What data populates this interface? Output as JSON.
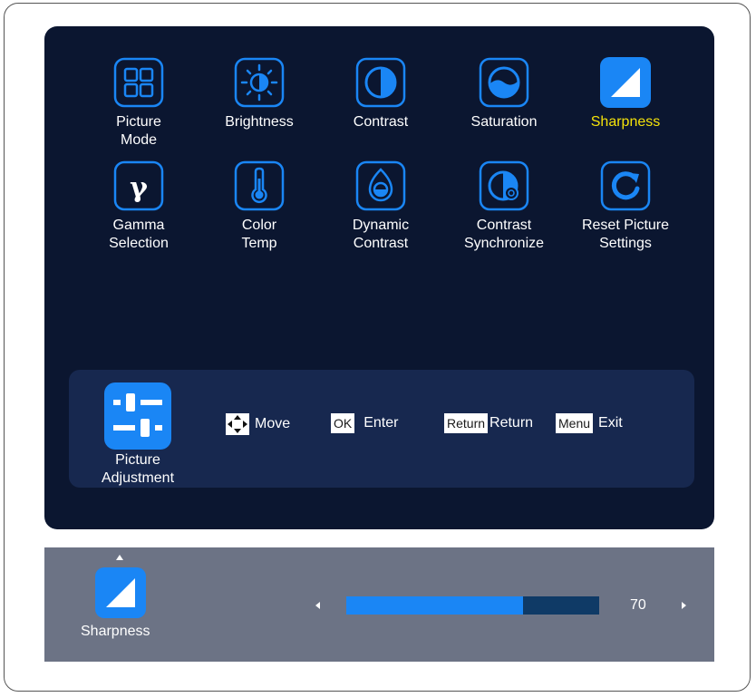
{
  "menu": {
    "active_color": "#f4e20a",
    "accent_color": "#1a86f5",
    "items": [
      {
        "label": "Picture\nMode",
        "icon": "picture-mode-icon"
      },
      {
        "label": "Brightness",
        "icon": "brightness-icon"
      },
      {
        "label": "Contrast",
        "icon": "contrast-icon"
      },
      {
        "label": "Saturation",
        "icon": "saturation-icon"
      },
      {
        "label": "Sharpness",
        "icon": "sharpness-icon",
        "selected": true
      },
      {
        "label": "Gamma\nSelection",
        "icon": "gamma-icon"
      },
      {
        "label": "Color\nTemp",
        "icon": "color-temp-icon"
      },
      {
        "label": "Dynamic\nContrast",
        "icon": "dynamic-contrast-icon"
      },
      {
        "label": "Contrast\nSynchronize",
        "icon": "contrast-synchronize-icon"
      },
      {
        "label": "Reset Picture\nSettings",
        "icon": "reset-icon"
      }
    ]
  },
  "footer": {
    "section_label": "Picture\nAdjustment",
    "section_icon": "picture-adjustment-icon",
    "hints": {
      "move_label": "Move",
      "ok_key": "OK",
      "enter_label": "Enter",
      "return_key": "Return",
      "return_label": "Return",
      "menu_key": "Menu",
      "exit_label": "Exit"
    }
  },
  "submenu": {
    "label": "Sharpness",
    "icon": "sharpness-icon",
    "value": "70",
    "max": 100
  }
}
